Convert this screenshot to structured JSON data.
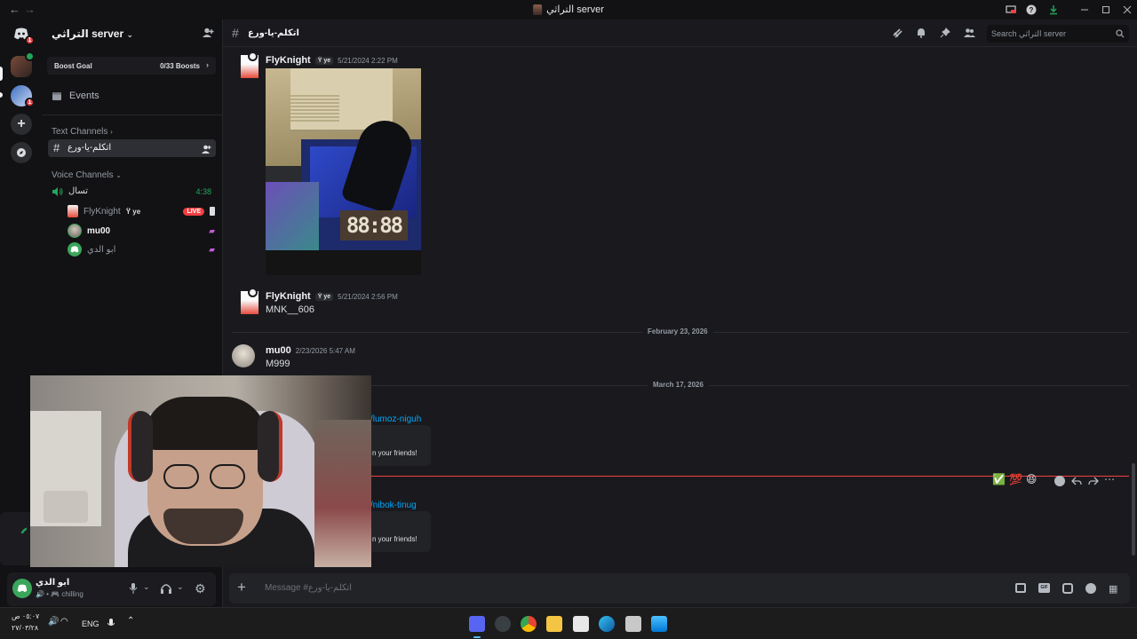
{
  "titlebar": {
    "back": "←",
    "forward": "→",
    "title": "التراثي server"
  },
  "rail": {
    "badges": [
      "1",
      "1",
      "1"
    ]
  },
  "sidebar": {
    "server_name": "التراثي server",
    "boost_label": "Boost Goal",
    "boost_count": "0/33 Boosts",
    "events_label": "Events",
    "text_channels_label": "Text Channels",
    "text_channel": "اتكلم-يا-ورع",
    "voice_channels_label": "Voice Channels",
    "voice_channel": "تسال",
    "voice_timer": "4:38",
    "voice_users": [
      {
        "name": "FlyKnight",
        "tag": "ye",
        "live": "LIVE"
      },
      {
        "name": "mu00"
      },
      {
        "name": "ابو الدي"
      }
    ]
  },
  "channel_header": {
    "name": "اتكلم-يا-ورع",
    "search_placeholder": "Search التراثي server"
  },
  "messages": [
    {
      "author": "FlyKnight",
      "tag": "ye",
      "time": "5/21/2024 2:22 PM",
      "text": ""
    },
    {
      "author": "FlyKnight",
      "tag": "ye",
      "time": "5/21/2024 2:56 PM",
      "text": "MNK__606"
    },
    {
      "author": "mu00",
      "time": "2/23/2026 5:47 AM",
      "text": "M999"
    }
  ],
  "date_dividers": [
    "February 23, 2026",
    "March 17, 2026"
  ],
  "invites": [
    {
      "link": "/lumoz-niguh",
      "text": "n your friends!"
    },
    {
      "link": "/nibok-tinug",
      "text": "n your friends!"
    }
  ],
  "reactions": [
    "✅",
    "💯",
    "😆"
  ],
  "composer": {
    "placeholder": "Message #اتكلم-يا-ورع"
  },
  "userpanel": {
    "name": "ابو الدي",
    "status": "chilling"
  },
  "taskbar": {
    "time": "٠٥:٠٧ ص",
    "date": "٢٧/٠٣/٢٨",
    "lang": "ENG"
  },
  "colors": {
    "accent": "#5865f2",
    "green": "#23a55a",
    "red": "#f23f43",
    "link": "#00a8fc"
  }
}
